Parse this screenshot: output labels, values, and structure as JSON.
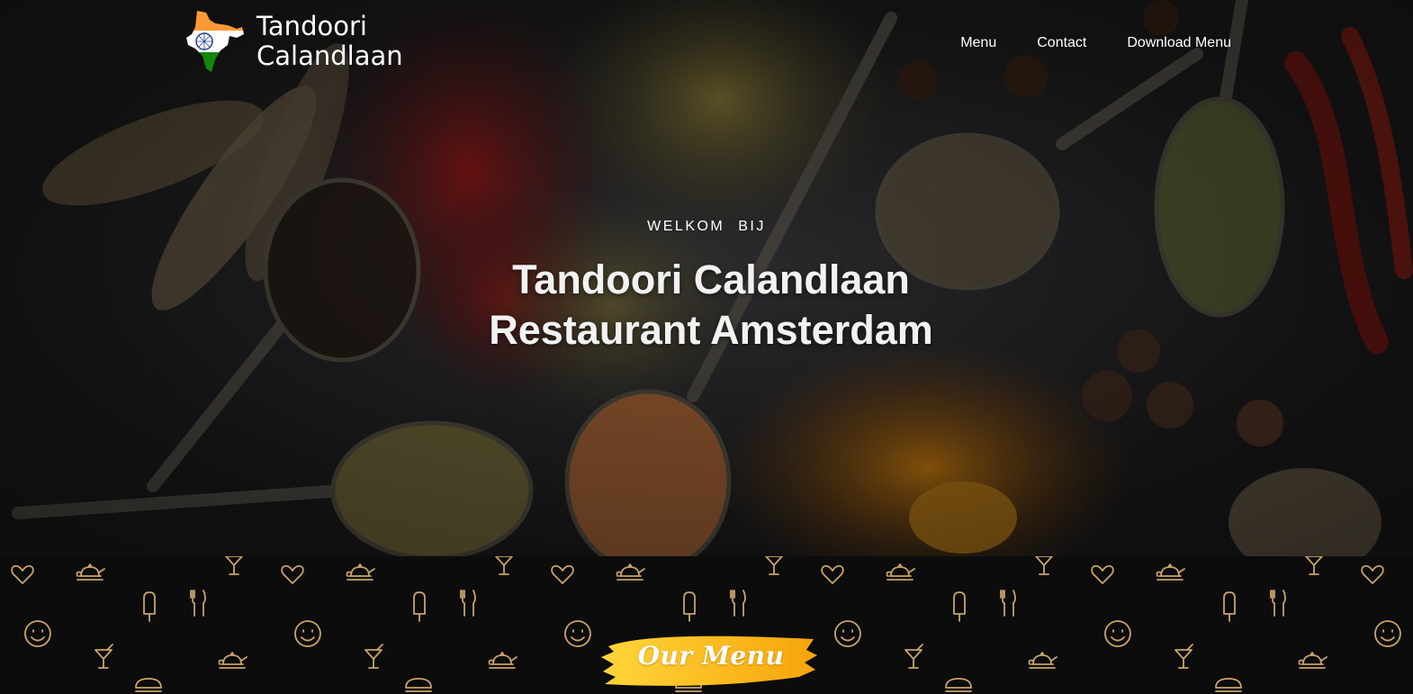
{
  "brand": {
    "name_line1": "Tandoori",
    "name_line2": "Calandlaan",
    "logo_icon": "india-map-flag-icon"
  },
  "nav": {
    "items": [
      {
        "label": "Menu"
      },
      {
        "label": "Contact"
      },
      {
        "label": "Download Menu"
      }
    ]
  },
  "hero": {
    "welcome_word1": "WELKOM",
    "welcome_word2": "BIJ",
    "title_line1": "Tandoori Calandlaan",
    "title_line2": "Restaurant Amsterdam",
    "background_image": "spices-on-spoons-photo"
  },
  "section": {
    "cta_label": "Our Menu",
    "pattern_icons": [
      "heart-icon",
      "teapot-icon",
      "cocktail-icon",
      "popsicle-icon",
      "cutlery-icon",
      "smiley-icon",
      "burger-icon"
    ],
    "pattern_color": "#c9a36a",
    "cta_color": "#f7b80f"
  },
  "colors": {
    "background": "#0c0c0c",
    "text": "#ffffff",
    "flag_saffron": "#ff9933",
    "flag_green": "#138808",
    "chakra_blue": "#1f3f9a"
  }
}
